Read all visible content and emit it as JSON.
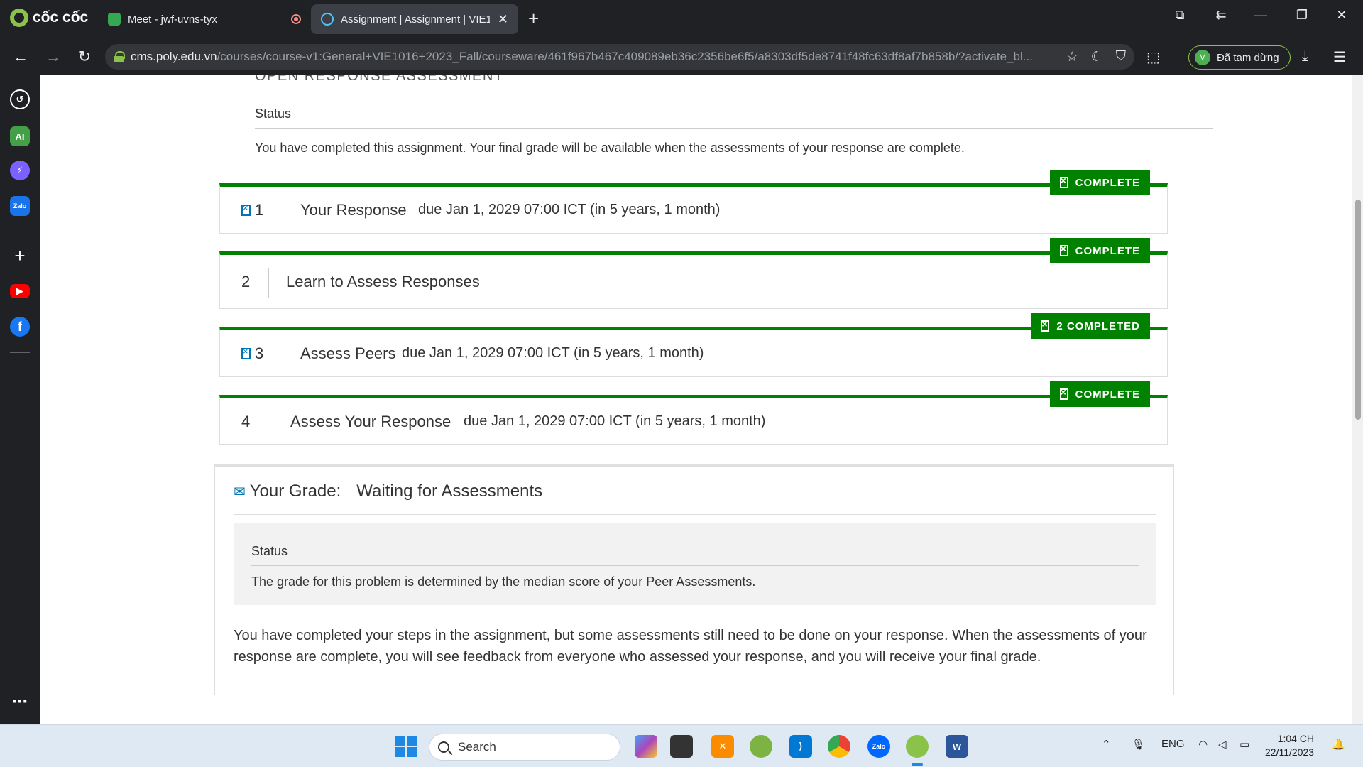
{
  "browser": {
    "brand": "cốc cốc",
    "tabs": [
      {
        "title": "Meet - jwf-uvns-tyx",
        "active": false
      },
      {
        "title": "Assignment | Assignment | VIE1(",
        "active": true
      }
    ],
    "url_host": "cms.poly.edu.vn",
    "url_path": "/courses/course-v1:General+VIE1016+2023_Fall/courseware/461f967b467c409089eb36c2356be6f5/a8303df5de8741f48fc63df8af7b858b/?activate_bl...",
    "profile_initial": "M",
    "profile_status": "Đã tạm dừng"
  },
  "sidebar": {
    "items": [
      {
        "name": "history-icon"
      },
      {
        "name": "ai-icon",
        "label": "AI"
      },
      {
        "name": "messenger-icon"
      },
      {
        "name": "zalo-icon",
        "label": "Zalo"
      },
      {
        "name": "add-icon"
      },
      {
        "name": "youtube-icon"
      },
      {
        "name": "facebook-icon",
        "label": "f"
      }
    ]
  },
  "page": {
    "section_title": "OPEN RESPONSE ASSESSMENT",
    "status_heading": "Status",
    "status_text": "You have completed this assignment. Your final grade will be available when the assessments of your response are complete.",
    "steps": [
      {
        "number": "1",
        "title": "Your Response",
        "due": "due Jan 1, 2029 07:00 ICT (in 5 years, 1 month)",
        "badge": "COMPLETE"
      },
      {
        "number": "2",
        "title": "Learn to Assess Responses",
        "due": "",
        "badge": "COMPLETE"
      },
      {
        "number": "3",
        "title": "Assess Peers",
        "due": "due Jan 1, 2029 07:00 ICT (in 5 years, 1 month)",
        "badge": "2 COMPLETED"
      },
      {
        "number": "4",
        "title": "Assess Your Response",
        "due": "due Jan 1, 2029 07:00 ICT (in 5 years, 1 month)",
        "badge": "COMPLETE"
      }
    ],
    "grade": {
      "label": "Your Grade:",
      "status": "Waiting for Assessments",
      "panel_heading": "Status",
      "panel_text": "The grade for this problem is determined by the median score of your Peer Assessments.",
      "message": "You have completed your steps in the assignment, but some assessments still need to be done on your response. When the assessments of your response are complete, you will see feedback from everyone who assessed your response, and you will receive your final grade."
    }
  },
  "taskbar": {
    "search_placeholder": "Search",
    "language": "ENG",
    "time": "1:04 CH",
    "date": "22/11/2023"
  },
  "colors": {
    "complete_green": "#008100",
    "link_blue": "#0075b4",
    "browser_dark": "#202124"
  }
}
